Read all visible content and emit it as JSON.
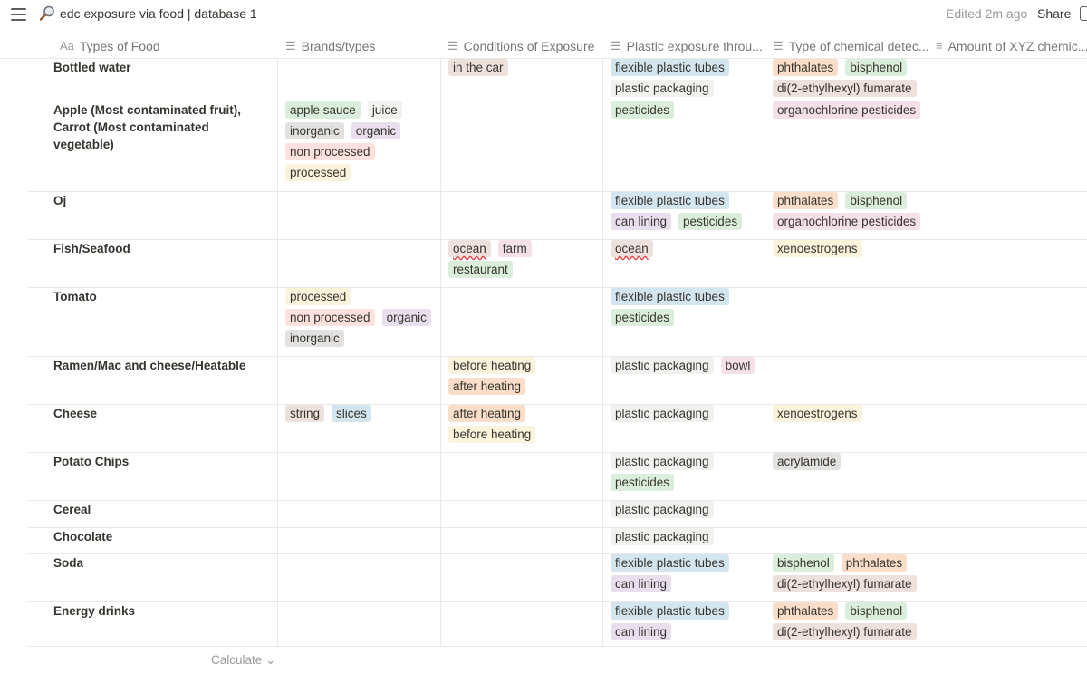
{
  "topbar": {
    "title": "edc exposure via food | database 1",
    "edited": "Edited 2m ago",
    "share": "Share"
  },
  "columns": [
    {
      "label": "Types of Food",
      "icon": "title-icon"
    },
    {
      "label": "Brands/types",
      "icon": "multi-select-icon"
    },
    {
      "label": "Conditions of Exposure",
      "icon": "multi-select-icon"
    },
    {
      "label": "Plastic exposure throu...",
      "icon": "multi-select-icon"
    },
    {
      "label": "Type of chemical detec...",
      "icon": "multi-select-icon"
    },
    {
      "label": "Amount of XYZ chemic...",
      "icon": "text-icon"
    }
  ],
  "rows": [
    {
      "name": "Bottled water",
      "brands": [],
      "conditions": [
        {
          "t": "in the car",
          "c": "brown"
        }
      ],
      "plastic": [
        {
          "t": "flexible plastic tubes",
          "c": "blue"
        },
        {
          "t": "plastic packaging",
          "c": "default"
        }
      ],
      "chemical": [
        {
          "t": "phthalates",
          "c": "orange"
        },
        {
          "t": "bisphenol",
          "c": "green"
        },
        {
          "t": "di(2-ethylhexyl) fumarate",
          "c": "brown"
        }
      ]
    },
    {
      "name": "Apple (Most contaminated fruit), Carrot (Most contaminated vegetable)",
      "brands": [
        {
          "t": "apple sauce",
          "c": "green"
        },
        {
          "t": "juice",
          "c": "default"
        },
        {
          "t": "inorganic",
          "c": "gray"
        },
        {
          "t": "organic",
          "c": "purple"
        },
        {
          "t": "non processed",
          "c": "red"
        },
        {
          "t": "processed",
          "c": "yellow"
        }
      ],
      "conditions": [],
      "plastic": [
        {
          "t": "pesticides",
          "c": "green"
        }
      ],
      "chemical": [
        {
          "t": "organochlorine pesticides",
          "c": "pink"
        }
      ]
    },
    {
      "name": "Oj",
      "brands": [],
      "conditions": [],
      "plastic": [
        {
          "t": "flexible plastic tubes",
          "c": "blue"
        },
        {
          "t": "can lining",
          "c": "purple"
        },
        {
          "t": "pesticides",
          "c": "green"
        }
      ],
      "chemical": [
        {
          "t": "phthalates",
          "c": "orange"
        },
        {
          "t": "bisphenol",
          "c": "green"
        },
        {
          "t": "organochlorine pesticides",
          "c": "pink"
        }
      ]
    },
    {
      "name": "Fish/Seafood",
      "brands": [],
      "conditions": [
        {
          "t": "ocean",
          "c": "brown",
          "u": true
        },
        {
          "t": "farm",
          "c": "pink"
        },
        {
          "t": "restaurant",
          "c": "green"
        }
      ],
      "plastic": [
        {
          "t": "ocean",
          "c": "brown",
          "u": true
        }
      ],
      "chemical": [
        {
          "t": "xenoestrogens",
          "c": "yellow"
        }
      ]
    },
    {
      "name": "Tomato",
      "brands": [
        {
          "t": "processed",
          "c": "yellow"
        },
        {
          "t": "non processed",
          "c": "red"
        },
        {
          "t": "organic",
          "c": "purple"
        },
        {
          "t": "inorganic",
          "c": "gray"
        }
      ],
      "conditions": [],
      "plastic": [
        {
          "t": "flexible plastic tubes",
          "c": "blue"
        },
        {
          "t": "pesticides",
          "c": "green"
        }
      ],
      "chemical": []
    },
    {
      "name": "Ramen/Mac and cheese/Heatable",
      "brands": [],
      "conditions": [
        {
          "t": "before heating",
          "c": "yellow"
        },
        {
          "t": "after heating",
          "c": "orange"
        }
      ],
      "plastic": [
        {
          "t": "plastic packaging",
          "c": "default"
        },
        {
          "t": "bowl",
          "c": "pink"
        }
      ],
      "chemical": []
    },
    {
      "name": "Cheese",
      "brands": [
        {
          "t": "string",
          "c": "brown"
        },
        {
          "t": "slices",
          "c": "blue"
        }
      ],
      "conditions": [
        {
          "t": "after heating",
          "c": "orange"
        },
        {
          "t": "before heating",
          "c": "yellow"
        }
      ],
      "plastic": [
        {
          "t": "plastic packaging",
          "c": "default"
        }
      ],
      "chemical": [
        {
          "t": "xenoestrogens",
          "c": "yellow"
        }
      ]
    },
    {
      "name": "Potato Chips",
      "brands": [],
      "conditions": [],
      "plastic": [
        {
          "t": "plastic packaging",
          "c": "default"
        },
        {
          "t": "pesticides",
          "c": "green"
        }
      ],
      "chemical": [
        {
          "t": "acrylamide",
          "c": "gray"
        }
      ]
    },
    {
      "name": "Cereal",
      "brands": [],
      "conditions": [],
      "plastic": [
        {
          "t": "plastic packaging",
          "c": "default"
        }
      ],
      "chemical": []
    },
    {
      "name": "Chocolate",
      "brands": [],
      "conditions": [],
      "plastic": [
        {
          "t": "plastic packaging",
          "c": "default"
        }
      ],
      "chemical": []
    },
    {
      "name": "Soda",
      "brands": [],
      "conditions": [],
      "plastic": [
        {
          "t": "flexible plastic tubes",
          "c": "blue"
        },
        {
          "t": "can lining",
          "c": "purple"
        }
      ],
      "chemical": [
        {
          "t": "bisphenol",
          "c": "green"
        },
        {
          "t": "phthalates",
          "c": "orange"
        },
        {
          "t": "di(2-ethylhexyl) fumarate",
          "c": "brown"
        }
      ]
    },
    {
      "name": "Energy drinks",
      "brands": [],
      "conditions": [],
      "plastic": [
        {
          "t": "flexible plastic tubes",
          "c": "blue"
        },
        {
          "t": "can lining",
          "c": "purple"
        }
      ],
      "chemical": [
        {
          "t": "phthalates",
          "c": "orange"
        },
        {
          "t": "bisphenol",
          "c": "green"
        },
        {
          "t": "di(2-ethylhexyl) fumarate",
          "c": "brown"
        }
      ]
    }
  ],
  "footer": {
    "calculate": "Calculate ⌄"
  }
}
